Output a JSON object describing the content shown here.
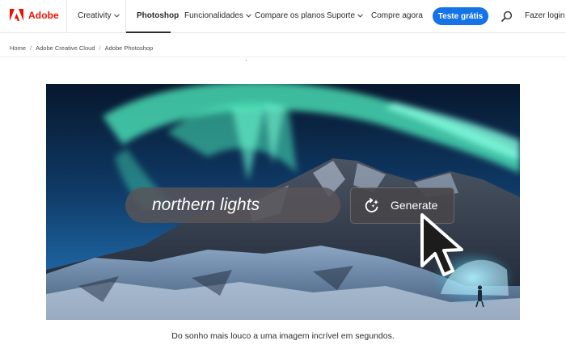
{
  "header": {
    "brand": "Adobe",
    "brand_color": "#eb1000",
    "nav": {
      "creativity": "Creativity",
      "photoshop": "Photoshop",
      "features": "Funcionalidades",
      "compare": "Compare os planos",
      "support": "Suporte",
      "buy": "Compre agora"
    },
    "cta_label": "Teste grátis",
    "cta_color": "#1473e6",
    "signin_label": "Fazer login",
    "search_icon": "search-icon"
  },
  "breadcrumb": {
    "items": [
      "Home",
      "Adobe Creative Cloud",
      "Adobe Photoshop"
    ],
    "separator": "/"
  },
  "hero": {
    "prompt_text": "northern lights",
    "generate_label": "Generate",
    "generate_icon": "sparkle-refresh-icon",
    "cursor_icon": "mouse-pointer-icon"
  },
  "caption": "Do sonho mais louco a uma imagem incrível em segundos."
}
